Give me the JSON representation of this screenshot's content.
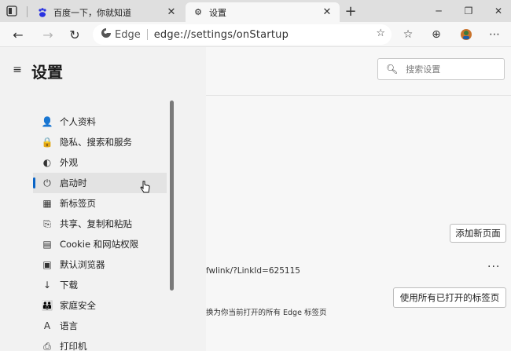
{
  "tabs": [
    {
      "title": "百度一下，你就知道",
      "favicon": "baidu-paw-icon"
    },
    {
      "title": "设置",
      "favicon": "gear-icon"
    }
  ],
  "address": {
    "brand": "Edge",
    "url": "edge://settings/onStartup"
  },
  "settings": {
    "title": "设置",
    "search_placeholder": "搜索设置",
    "nav_items": [
      {
        "label": "个人资料",
        "icon": "profile-icon"
      },
      {
        "label": "隐私、搜索和服务",
        "icon": "lock-icon"
      },
      {
        "label": "外观",
        "icon": "appearance-icon"
      },
      {
        "label": "启动时",
        "icon": "power-icon"
      },
      {
        "label": "新标签页",
        "icon": "new-tab-icon"
      },
      {
        "label": "共享、复制和粘贴",
        "icon": "share-icon"
      },
      {
        "label": "Cookie 和网站权限",
        "icon": "cookie-icon"
      },
      {
        "label": "默认浏览器",
        "icon": "default-browser-icon"
      },
      {
        "label": "下载",
        "icon": "download-icon"
      },
      {
        "label": "家庭安全",
        "icon": "family-icon"
      },
      {
        "label": "语言",
        "icon": "language-icon"
      },
      {
        "label": "打印机",
        "icon": "printer-icon"
      }
    ],
    "active_item": "启动时"
  },
  "main": {
    "add_page_button": "添加新页面",
    "link_fragment": "fwlink/?LinkId=625115",
    "more_label": "...",
    "use_open_tabs_button": "使用所有已打开的标签页",
    "description_fragment": "换为你当前打开的所有 Edge 标签页"
  },
  "colors": {
    "accent": "#0a64c6",
    "tabstrip": "#dfdfdf",
    "sidebar": "#f2f2f2"
  }
}
